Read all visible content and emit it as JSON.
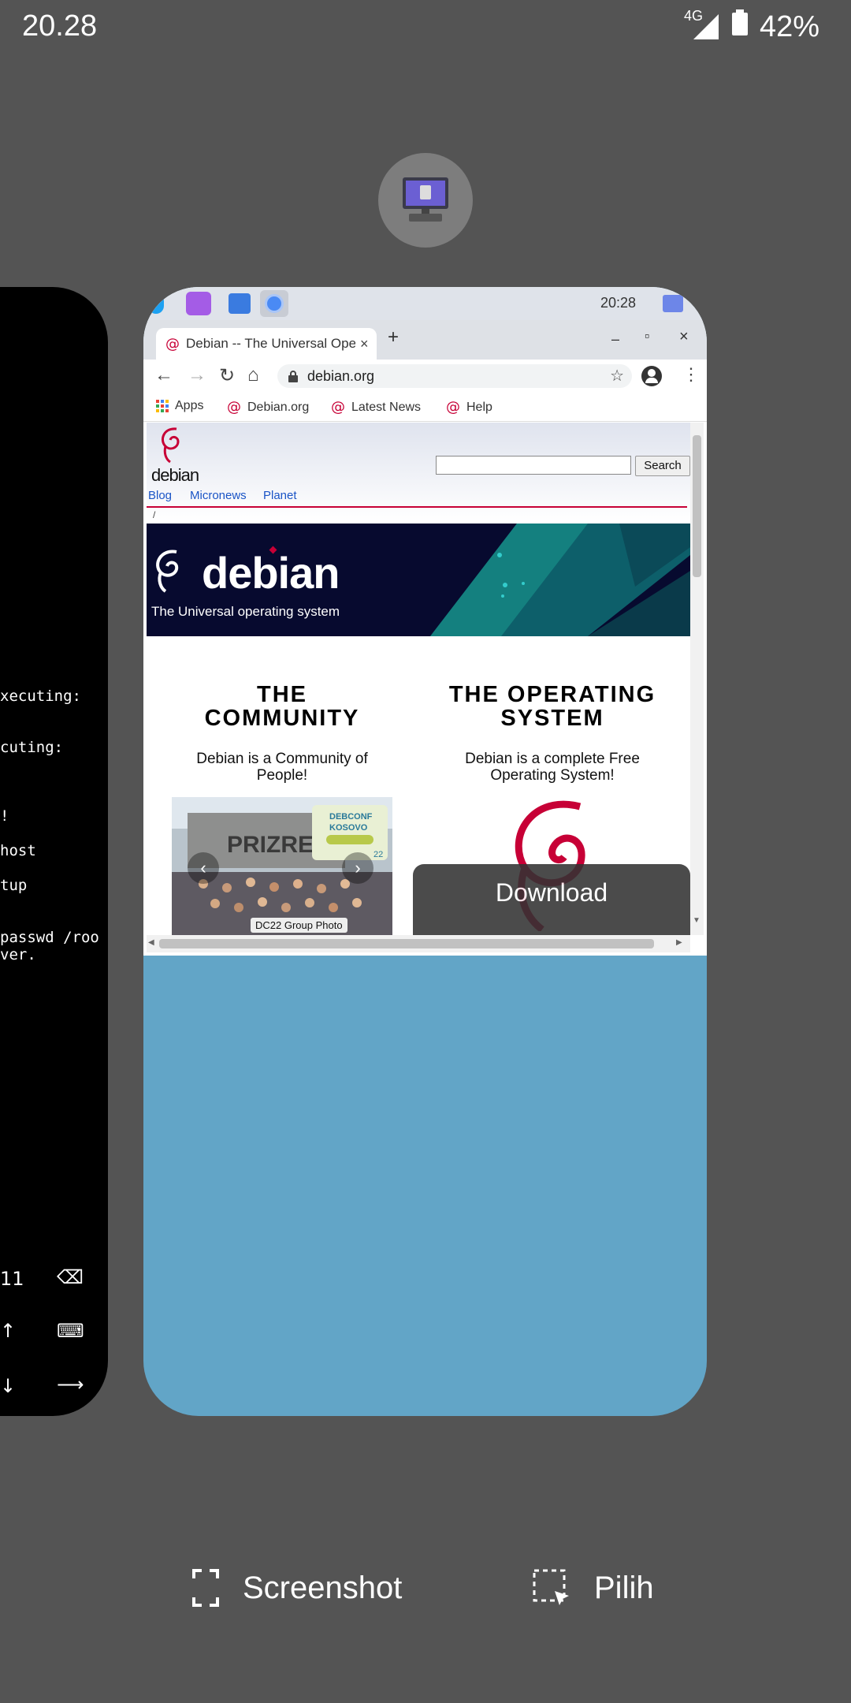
{
  "status_bar": {
    "time": "20.28",
    "network": "4G",
    "battery": "42%"
  },
  "terminal": {
    "lines": [
      "xecuting:",
      "cuting:",
      "!",
      "host",
      "tup",
      "passwd /roo",
      "ver."
    ],
    "keys": {
      "num": "11",
      "backspace_icon": "⌫",
      "keyboard_icon": "⌨",
      "arrow": "⟶"
    }
  },
  "chrome_shelf": {
    "time": "20:28"
  },
  "browser": {
    "tab_title": "Debian -- The Universal Operating System",
    "tab_close": "×",
    "new_tab": "+",
    "window_controls": {
      "minimize": "–",
      "maximize": "▫",
      "close": "×"
    },
    "url": "debian.org",
    "bookmarks": [
      {
        "label": "Apps"
      },
      {
        "label": "Debian.org"
      },
      {
        "label": "Latest News"
      },
      {
        "label": "Help"
      }
    ]
  },
  "page": {
    "logo_word": "debian",
    "search_button": "Search",
    "nav_links": [
      "Blog",
      "Micronews",
      "Planet"
    ],
    "breadcrumb": "/",
    "banner": {
      "word": "debian",
      "tagline": "The Universal operating system"
    },
    "community": {
      "title_line1": "THE",
      "title_line2": "COMMUNITY",
      "text_line1": "Debian is a Community of",
      "text_line2": "People!",
      "photo_caption": "DC22 Group Photo"
    },
    "os": {
      "title_line1": "THE OPERATING",
      "title_line2": "SYSTEM",
      "text_line1": "Debian is a complete Free",
      "text_line2": "Operating System!",
      "download": "Download"
    }
  },
  "actions": {
    "screenshot": "Screenshot",
    "select": "Pilih"
  }
}
